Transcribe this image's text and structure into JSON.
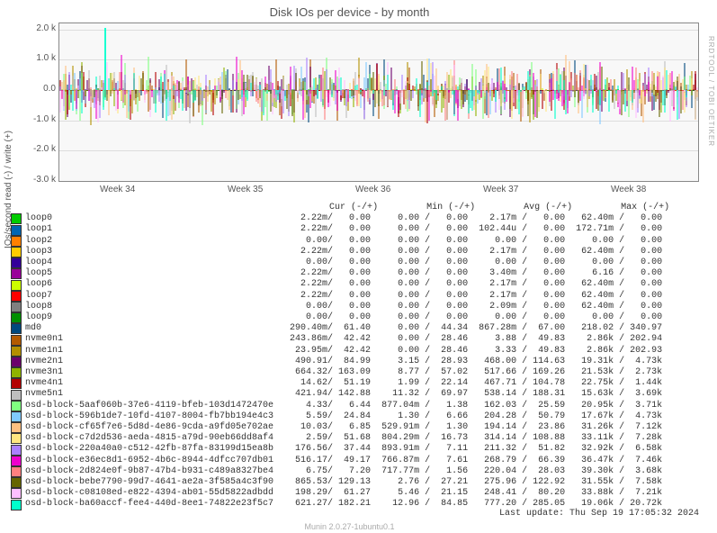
{
  "title": "Disk IOs per device - by month",
  "y_axis_label": "IOs/second read (-) / write (+)",
  "side_label": "RRDTOOL / TOBI OETIKER",
  "footer": "Munin 2.0.27-1ubuntu0.1",
  "last_update": "Last update: Thu Sep 19 17:05:32 2024",
  "chart_data": {
    "type": "line",
    "xlabel": "",
    "ylabel": "IOs/second read (-) / write (+)",
    "x_ticks": [
      "Week 34",
      "Week 35",
      "Week 36",
      "Week 37",
      "Week 38"
    ],
    "y_ticks": [
      "-3.0 k",
      "-2.0 k",
      "-1.0 k",
      "0.0",
      "1.0 k",
      "2.0 k"
    ],
    "ylim": [
      -3000,
      2200
    ],
    "legend_header_cols": [
      "Cur (-/+)",
      "Min (-/+)",
      "Avg (-/+)",
      "Max (-/+)"
    ],
    "series": [
      {
        "name": "loop0",
        "color": "#00cc00",
        "cur_n": "2.22m",
        "cur_p": "0.00",
        "min_n": "0.00",
        "min_p": "0.00",
        "avg_n": "2.17m",
        "avg_p": "0.00",
        "max_n": "62.40m",
        "max_p": "0.00"
      },
      {
        "name": "loop1",
        "color": "#0066b3",
        "cur_n": "2.22m",
        "cur_p": "0.00",
        "min_n": "0.00",
        "min_p": "0.00",
        "avg_n": "102.44u",
        "avg_p": "0.00",
        "max_n": "172.71m",
        "max_p": "0.00"
      },
      {
        "name": "loop2",
        "color": "#ff8000",
        "cur_n": "0.00",
        "cur_p": "0.00",
        "min_n": "0.00",
        "min_p": "0.00",
        "avg_n": "0.00",
        "avg_p": "0.00",
        "max_n": "0.00",
        "max_p": "0.00"
      },
      {
        "name": "loop3",
        "color": "#ffcc00",
        "cur_n": "2.22m",
        "cur_p": "0.00",
        "min_n": "0.00",
        "min_p": "0.00",
        "avg_n": "2.17m",
        "avg_p": "0.00",
        "max_n": "62.40m",
        "max_p": "0.00"
      },
      {
        "name": "loop4",
        "color": "#330099",
        "cur_n": "0.00",
        "cur_p": "0.00",
        "min_n": "0.00",
        "min_p": "0.00",
        "avg_n": "0.00",
        "avg_p": "0.00",
        "max_n": "0.00",
        "max_p": "0.00"
      },
      {
        "name": "loop5",
        "color": "#990099",
        "cur_n": "2.22m",
        "cur_p": "0.00",
        "min_n": "0.00",
        "min_p": "0.00",
        "avg_n": "3.40m",
        "avg_p": "0.00",
        "max_n": "6.16",
        "max_p": "0.00"
      },
      {
        "name": "loop6",
        "color": "#ccff00",
        "cur_n": "2.22m",
        "cur_p": "0.00",
        "min_n": "0.00",
        "min_p": "0.00",
        "avg_n": "2.17m",
        "avg_p": "0.00",
        "max_n": "62.40m",
        "max_p": "0.00"
      },
      {
        "name": "loop7",
        "color": "#ff0000",
        "cur_n": "2.22m",
        "cur_p": "0.00",
        "min_n": "0.00",
        "min_p": "0.00",
        "avg_n": "2.17m",
        "avg_p": "0.00",
        "max_n": "62.40m",
        "max_p": "0.00"
      },
      {
        "name": "loop8",
        "color": "#808080",
        "cur_n": "0.00",
        "cur_p": "0.00",
        "min_n": "0.00",
        "min_p": "0.00",
        "avg_n": "2.09m",
        "avg_p": "0.00",
        "max_n": "62.40m",
        "max_p": "0.00"
      },
      {
        "name": "loop9",
        "color": "#008f00",
        "cur_n": "0.00",
        "cur_p": "0.00",
        "min_n": "0.00",
        "min_p": "0.00",
        "avg_n": "0.00",
        "avg_p": "0.00",
        "max_n": "0.00",
        "max_p": "0.00"
      },
      {
        "name": "md0",
        "color": "#00487d",
        "cur_n": "290.40m",
        "cur_p": "61.40",
        "min_n": "0.00",
        "min_p": "44.34",
        "avg_n": "867.28m",
        "avg_p": "67.00",
        "max_n": "218.02",
        "max_p": "340.97"
      },
      {
        "name": "nvme0n1",
        "color": "#b35a00",
        "cur_n": "243.86m",
        "cur_p": "42.42",
        "min_n": "0.00",
        "min_p": "28.46",
        "avg_n": "3.88",
        "avg_p": "49.83",
        "max_n": "2.86k",
        "max_p": "202.94"
      },
      {
        "name": "nvme1n1",
        "color": "#b38f00",
        "cur_n": "23.95m",
        "cur_p": "42.42",
        "min_n": "0.00",
        "min_p": "28.46",
        "avg_n": "3.33",
        "avg_p": "49.83",
        "max_n": "2.86k",
        "max_p": "202.93"
      },
      {
        "name": "nvme2n1",
        "color": "#6b006b",
        "cur_n": "490.91",
        "cur_p": "84.99",
        "min_n": "3.15",
        "min_p": "28.93",
        "avg_n": "468.00",
        "avg_p": "114.63",
        "max_n": "19.31k",
        "max_p": "4.73k"
      },
      {
        "name": "nvme3n1",
        "color": "#8fb300",
        "cur_n": "664.32",
        "cur_p": "163.09",
        "min_n": "8.77",
        "min_p": "57.02",
        "avg_n": "517.66",
        "avg_p": "169.26",
        "max_n": "21.53k",
        "max_p": "2.73k"
      },
      {
        "name": "nvme4n1",
        "color": "#b30000",
        "cur_n": "14.62",
        "cur_p": "51.19",
        "min_n": "1.99",
        "min_p": "22.14",
        "avg_n": "467.71",
        "avg_p": "104.78",
        "max_n": "22.75k",
        "max_p": "1.44k"
      },
      {
        "name": "nvme5n1",
        "color": "#bebebe",
        "cur_n": "421.94",
        "cur_p": "142.88",
        "min_n": "11.32",
        "min_p": "69.97",
        "avg_n": "538.14",
        "avg_p": "188.31",
        "max_n": "15.63k",
        "max_p": "3.69k"
      },
      {
        "name": "osd-block-5aaf060b-37e6-4119-bfeb-103d1472470e",
        "color": "#80ff80",
        "cur_n": "4.33",
        "cur_p": "6.44",
        "min_n": "877.04m",
        "min_p": "1.38",
        "avg_n": "162.03",
        "avg_p": "25.59",
        "max_n": "20.95k",
        "max_p": "3.71k"
      },
      {
        "name": "osd-block-596b1de7-10fd-4107-8004-fb7bb194e4c3",
        "color": "#80c9ff",
        "cur_n": "5.59",
        "cur_p": "24.84",
        "min_n": "1.30",
        "min_p": "6.66",
        "avg_n": "204.28",
        "avg_p": "50.79",
        "max_n": "17.67k",
        "max_p": "4.73k"
      },
      {
        "name": "osd-block-cf65f7e6-5d8d-4e86-9cda-a9fd05e702ae",
        "color": "#ffc080",
        "cur_n": "10.03",
        "cur_p": "6.85",
        "min_n": "529.91m",
        "min_p": "1.30",
        "avg_n": "194.14",
        "avg_p": "23.86",
        "max_n": "31.26k",
        "max_p": "7.12k"
      },
      {
        "name": "osd-block-c7d2d536-aeda-4815-a79d-90eb66dd8af4",
        "color": "#ffe680",
        "cur_n": "2.59",
        "cur_p": "51.68",
        "min_n": "804.29m",
        "min_p": "16.73",
        "avg_n": "314.14",
        "avg_p": "108.88",
        "max_n": "33.11k",
        "max_p": "7.28k"
      },
      {
        "name": "osd-block-220a40a0-c512-42fb-87fa-83199d15ea8b",
        "color": "#aa80ff",
        "cur_n": "176.56",
        "cur_p": "37.44",
        "min_n": "893.91m",
        "min_p": "7.11",
        "avg_n": "211.32",
        "avg_p": "51.82",
        "max_n": "32.92k",
        "max_p": "6.58k"
      },
      {
        "name": "osd-block-e36ec8d1-6952-4b6c-8944-4dfcc707db01",
        "color": "#ee00cc",
        "cur_n": "516.17",
        "cur_p": "49.17",
        "min_n": "766.87m",
        "min_p": "7.61",
        "avg_n": "268.79",
        "avg_p": "66.39",
        "max_n": "36.47k",
        "max_p": "7.46k"
      },
      {
        "name": "osd-block-2d824e0f-9b87-47b4-b931-c489a8327be4",
        "color": "#ff8080",
        "cur_n": "6.75",
        "cur_p": "7.20",
        "min_n": "717.77m",
        "min_p": "1.56",
        "avg_n": "220.04",
        "avg_p": "28.03",
        "max_n": "39.30k",
        "max_p": "3.68k"
      },
      {
        "name": "osd-block-bebe7790-99d7-4641-ae2a-3f585a4c3f90",
        "color": "#666600",
        "cur_n": "865.53",
        "cur_p": "129.13",
        "min_n": "2.76",
        "min_p": "27.21",
        "avg_n": "275.96",
        "avg_p": "122.92",
        "max_n": "31.55k",
        "max_p": "7.58k"
      },
      {
        "name": "osd-block-c08108ed-e822-4394-ab01-55d5822adbdd",
        "color": "#ffbfff",
        "cur_n": "198.29",
        "cur_p": "61.27",
        "min_n": "5.46",
        "min_p": "21.15",
        "avg_n": "248.41",
        "avg_p": "80.20",
        "max_n": "33.88k",
        "max_p": "7.21k"
      },
      {
        "name": "osd-block-ba60accf-fee4-440d-8ee1-74822e23f5c7",
        "color": "#00ffcc",
        "cur_n": "621.27",
        "cur_p": "182.21",
        "min_n": "12.96",
        "min_p": "84.85",
        "avg_n": "777.20",
        "avg_p": "285.05",
        "max_n": "19.06k",
        "max_p": "20.72k"
      }
    ]
  }
}
